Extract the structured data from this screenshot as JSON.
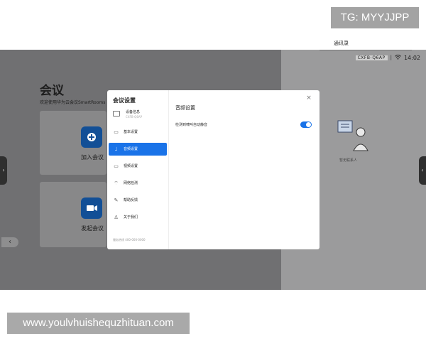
{
  "watermark": {
    "tg": "TG: MYYJJPP",
    "url": "www.youlvhuishequzhituan.com"
  },
  "status_bar": {
    "device_code": "CXFB-Q6AP",
    "separator": "|",
    "time": "14:02",
    "icons": [
      "wifi-icon"
    ]
  },
  "meeting": {
    "title": "会议",
    "subtitle": "欢迎使用华为云会议SmartRooms",
    "join_label": "加入会议",
    "start_label": "发起会议",
    "join_icon": "plus-icon",
    "start_icon": "video-camera-icon"
  },
  "contacts": {
    "title": "通讯录",
    "empty_text": "暂无联系人"
  },
  "dialog": {
    "title": "会议设置",
    "close_glyph": "×",
    "device_info": {
      "label": "设备信息",
      "sub": "CXFB-Q6AP"
    },
    "menu": [
      {
        "label": "基本设置",
        "icon": "settings-icon",
        "glyph": "▭",
        "active": false
      },
      {
        "label": "音频设置",
        "icon": "microphone-icon",
        "glyph": "♩",
        "active": true
      },
      {
        "label": "视频设置",
        "icon": "video-icon",
        "glyph": "▭",
        "active": false
      },
      {
        "label": "网络检测",
        "icon": "wifi-icon",
        "glyph": "⌔",
        "active": false
      },
      {
        "label": "帮助反馈",
        "icon": "feedback-icon",
        "glyph": "✎",
        "active": false
      },
      {
        "label": "关于我们",
        "icon": "user-icon",
        "glyph": "♙",
        "active": false
      }
    ],
    "service_line": "服务热线 400-000-0000",
    "content_title": "音频设置",
    "setting": {
      "label": "检测到啸叫自动静音",
      "enabled": true
    }
  },
  "colors": {
    "accent": "#1a73e8",
    "tile_icon": "#124f96",
    "overlay": "#707072"
  }
}
